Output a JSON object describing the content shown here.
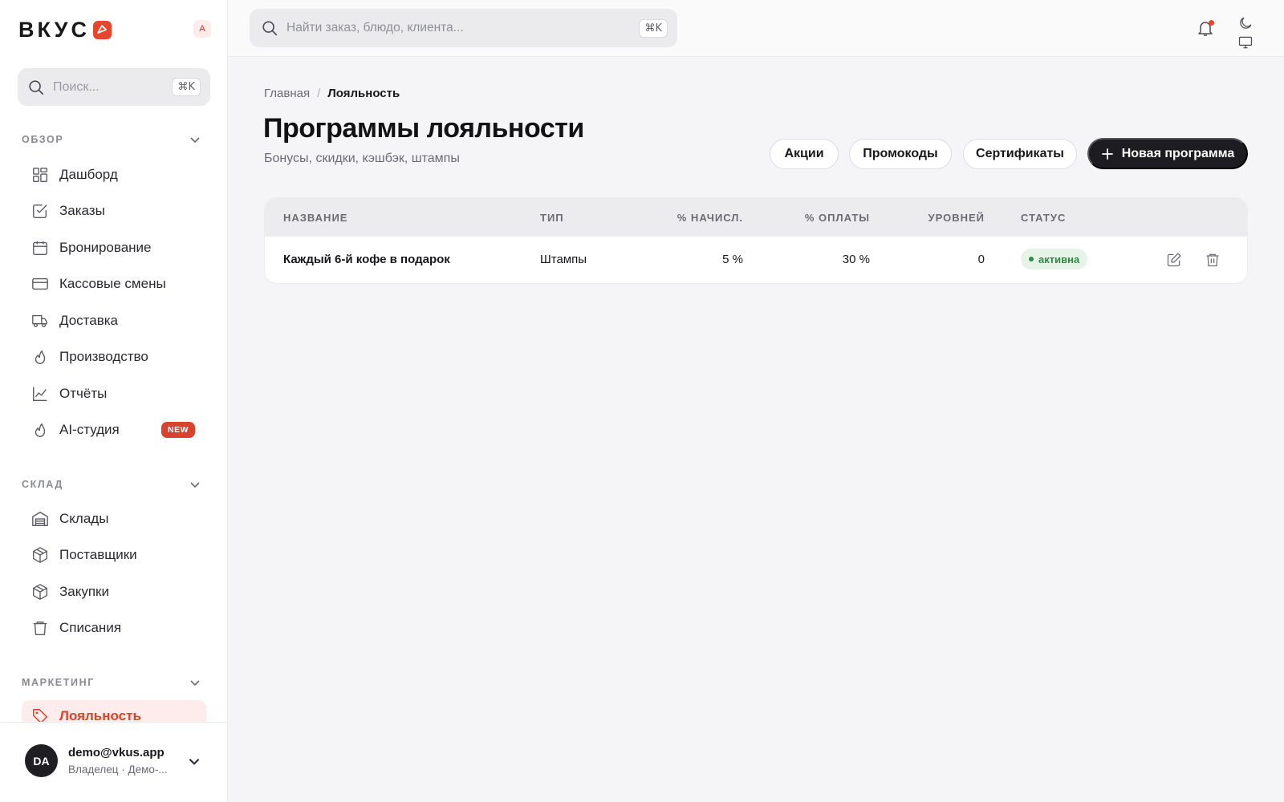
{
  "brand": {
    "name": "ВКУС",
    "user_initial": "A",
    "accent": "#e8462c"
  },
  "sidebar": {
    "search": {
      "placeholder": "Поиск...",
      "shortcut": "⌘K"
    },
    "sections": [
      {
        "title": "ОБЗОР",
        "items": [
          {
            "label": "Дашборд",
            "icon": "grid-icon"
          },
          {
            "label": "Заказы",
            "icon": "checkbox-icon"
          },
          {
            "label": "Бронирование",
            "icon": "calendar-icon"
          },
          {
            "label": "Кассовые смены",
            "icon": "credit-card-icon"
          },
          {
            "label": "Доставка",
            "icon": "truck-icon"
          },
          {
            "label": "Производство",
            "icon": "flame-icon"
          },
          {
            "label": "Отчёты",
            "icon": "chart-line-icon"
          },
          {
            "label": "AI-студия",
            "icon": "flame-icon",
            "badge": "NEW"
          }
        ]
      },
      {
        "title": "СКЛАД",
        "items": [
          {
            "label": "Склады",
            "icon": "warehouse-icon"
          },
          {
            "label": "Поставщики",
            "icon": "box-icon"
          },
          {
            "label": "Закупки",
            "icon": "box-icon"
          },
          {
            "label": "Списания",
            "icon": "trash-icon"
          }
        ]
      },
      {
        "title": "МАРКЕТИНГ",
        "items": [
          {
            "label": "Лояльность",
            "icon": "tag-icon",
            "active": true
          }
        ]
      }
    ],
    "user": {
      "initials": "DA",
      "email": "demo@vkus.app",
      "role": "Владелец · Демо-..."
    }
  },
  "topbar": {
    "search": {
      "placeholder": "Найти заказ, блюдо, клиента...",
      "shortcut": "⌘K"
    }
  },
  "breadcrumb": {
    "home": "Главная",
    "separator": "/",
    "current": "Лояльность"
  },
  "page": {
    "title": "Программы лояльности",
    "subtitle": "Бонусы, скидки, кэшбэк, штампы",
    "buttons": {
      "promos": "Акции",
      "promocodes": "Промокоды",
      "certificates": "Сертификаты",
      "new_program": "Новая программа"
    }
  },
  "table": {
    "columns": [
      "НАЗВАНИЕ",
      "ТИП",
      "% НАЧИСЛ.",
      "% ОПЛАТЫ",
      "УРОВНЕЙ",
      "СТАТУС"
    ],
    "rows": [
      {
        "name": "Каждый 6-й кофе в подарок",
        "type": "Штампы",
        "accrual": "5 %",
        "payment": "30 %",
        "levels": "0",
        "status": "активна"
      }
    ]
  }
}
